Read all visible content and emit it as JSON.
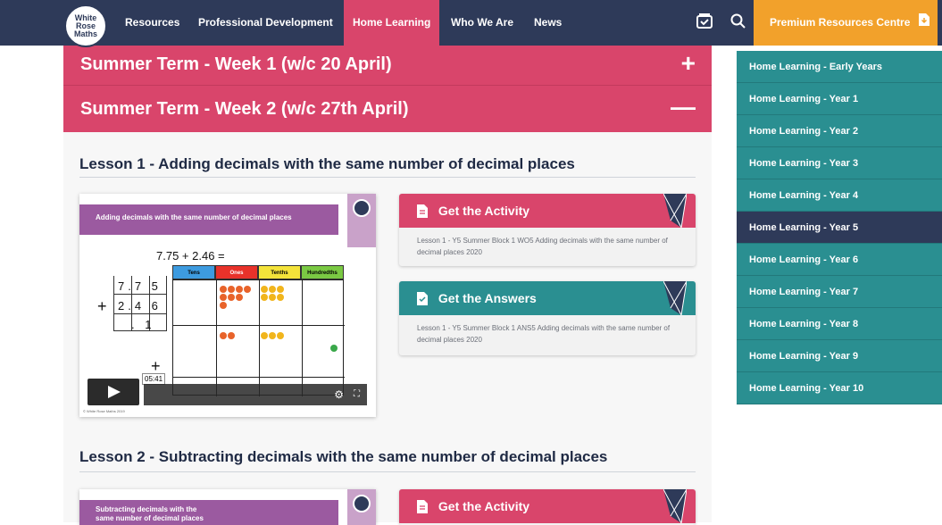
{
  "nav": {
    "logo_lines": [
      "White",
      "Rose",
      "Maths"
    ],
    "items": [
      {
        "label": "Resources"
      },
      {
        "label": "Professional Development"
      },
      {
        "label": "Home Learning",
        "active": true
      },
      {
        "label": "Who We Are"
      },
      {
        "label": "News"
      }
    ],
    "icons": [
      "basket-icon",
      "search-icon"
    ],
    "premium_label": "Premium Resources Centre"
  },
  "accordions": [
    {
      "title": "Summer Term - Week 1 (w/c 20 April)",
      "toggle": "+"
    },
    {
      "title": "Summer Term - Week 2 (w/c 27th April)",
      "toggle": "—"
    }
  ],
  "lessons": [
    {
      "title": "Lesson 1 - Adding decimals with the same number of decimal places",
      "video": {
        "banner": "Adding decimals with the same number of decimal places",
        "equation": "7.75 + 2.46 =",
        "columns": [
          "Tens",
          "Ones",
          "Tenths",
          "Hundredths"
        ],
        "row1": "7.7 5",
        "row2": "2.4 6",
        "result": ". 1",
        "duration": "05:41",
        "copyright": "© White Rose Maths 2019"
      },
      "activity": {
        "label": "Get the Activity",
        "desc": "Lesson 1 - Y5 Summer Block 1 WO5 Adding decimals with the same number of decimal places 2020"
      },
      "answers": {
        "label": "Get the Answers",
        "desc": "Lesson 1 - Y5 Summer Block 1 ANS5 Adding decimals with the same number of decimal places 2020"
      }
    },
    {
      "title": "Lesson 2 - Subtracting decimals with the same number of decimal places",
      "video": {
        "banner": "Subtracting decimals with the same number of decimal places"
      },
      "activity": {
        "label": "Get the Activity"
      }
    }
  ],
  "sidebar": {
    "items": [
      {
        "label": "Home Learning - Early Years"
      },
      {
        "label": "Home Learning - Year 1"
      },
      {
        "label": "Home Learning - Year 2"
      },
      {
        "label": "Home Learning - Year 3"
      },
      {
        "label": "Home Learning - Year 4"
      },
      {
        "label": "Home Learning - Year 5",
        "active": true
      },
      {
        "label": "Home Learning - Year 6"
      },
      {
        "label": "Home Learning - Year 7"
      },
      {
        "label": "Home Learning - Year 8"
      },
      {
        "label": "Home Learning - Year 9"
      },
      {
        "label": "Home Learning - Year 10"
      }
    ]
  },
  "colors": {
    "navy": "#2e3a59",
    "pink": "#d9456b",
    "teal": "#2a8f91",
    "orange": "#f2a12b",
    "purple": "#9b5aa0"
  }
}
